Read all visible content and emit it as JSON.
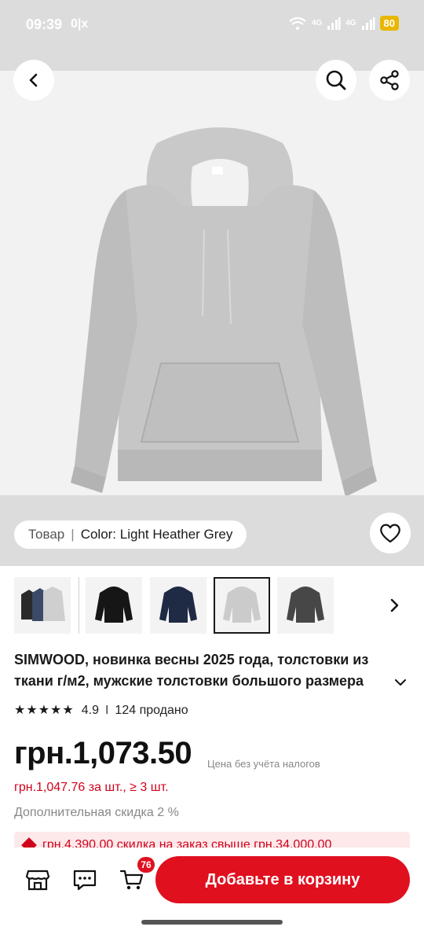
{
  "status_bar": {
    "time": "09:39",
    "notif": "0|x",
    "network1": "4G",
    "network2": "4G",
    "battery": "80"
  },
  "header": {
    "back_icon": "chevron-left-icon",
    "search_icon": "search-icon",
    "share_icon": "share-icon"
  },
  "variant": {
    "label": "Товар",
    "separator": "|",
    "value": "Color: Light Heather Grey"
  },
  "thumbnails": [
    {
      "name": "multi-color",
      "selected": false
    },
    {
      "name": "black",
      "selected": false
    },
    {
      "name": "navy",
      "selected": false
    },
    {
      "name": "light-heather-grey",
      "selected": true
    },
    {
      "name": "dark-grey",
      "selected": false
    }
  ],
  "product": {
    "title": "SIMWOOD, новинка весны 2025 года, толстовки из ткани г/м2, мужские толстовки большого размера",
    "rating": "4.9",
    "rating_sep": "I",
    "sold": "124 продано",
    "price": "грн.1,073.50",
    "tax_note": "Цена без учёта налогов",
    "bulk_price": "грн.1,047.76 за шт., ≥ 3 шт.",
    "extra_discount": "Дополнительная скидка 2 %",
    "promo": "грн.4,390.00 скидка на заказ свыше грн.34,000.00"
  },
  "bottom_bar": {
    "cart_count": "76",
    "add_to_cart": "Добавьте в корзину"
  },
  "colors": {
    "accent": "#e0101f",
    "price_red": "#d0021b",
    "hoodie_grey": "#c9c9c9"
  }
}
